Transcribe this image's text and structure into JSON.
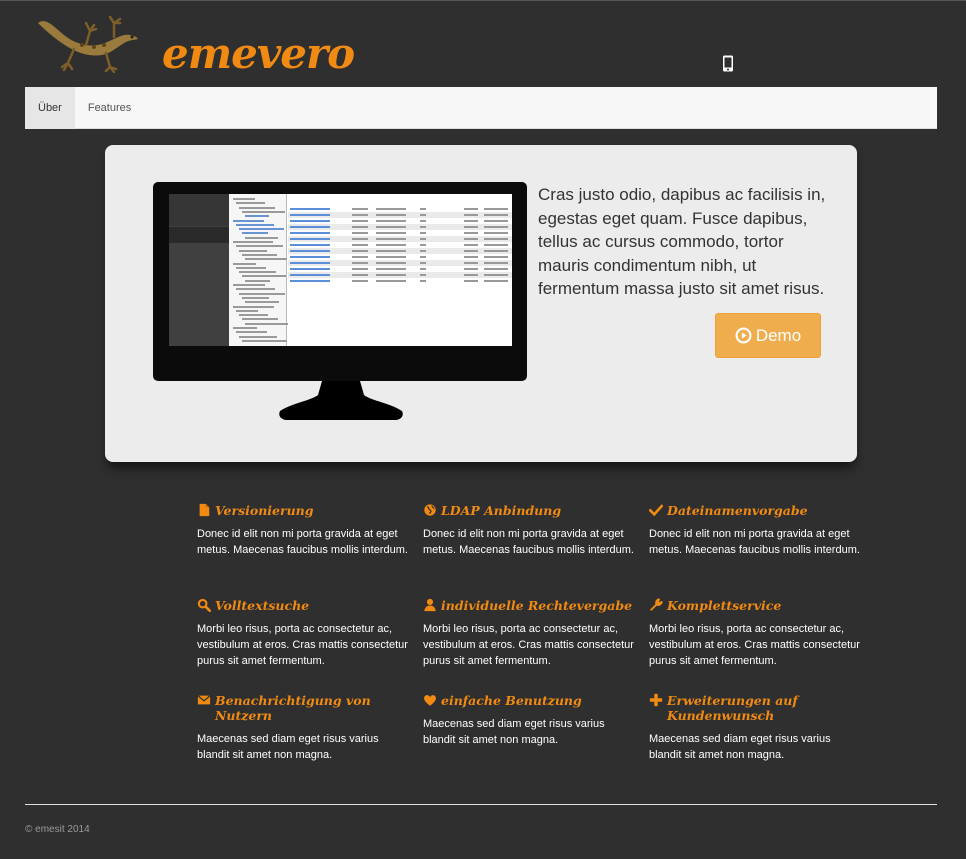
{
  "header": {
    "brand": "emevero",
    "logo_icon": "gecko-logo-icon",
    "mobile_icon": "mobile-phone-icon"
  },
  "nav": {
    "items": [
      {
        "label": "Über",
        "active": true
      },
      {
        "label": "Features",
        "active": false
      }
    ]
  },
  "hero": {
    "text": "Cras justo odio, dapibus ac facilisis in, egestas eget quam. Fusce dapibus, tellus ac cursus commodo, tortor mauris condimentum nibh, ut fermentum massa justo sit amet risus.",
    "demo_label": "Demo",
    "demo_icon": "play-circle-icon",
    "button_color": "#f0ad4e"
  },
  "features": [
    {
      "icon": "file-icon",
      "title": "Versionierung",
      "text": "Donec id elit non mi porta gravida at eget metus. Maecenas faucibus mollis interdum."
    },
    {
      "icon": "globe-icon",
      "title": "LDAP Anbindung",
      "text": "Donec id elit non mi porta gravida at eget metus. Maecenas faucibus mollis interdum."
    },
    {
      "icon": "check-icon",
      "title": "Dateinamenvorgabe",
      "text": "Donec id elit non mi porta gravida at eget metus. Maecenas faucibus mollis interdum."
    },
    {
      "icon": "search-icon",
      "title": "Volltextsuche",
      "text": "Morbi leo risus, porta ac consectetur ac, vestibulum at eros. Cras mattis consectetur purus sit amet fermentum."
    },
    {
      "icon": "user-icon",
      "title": "individuelle Rechtevergabe",
      "text": "Morbi leo risus, porta ac consectetur ac, vestibulum at eros. Cras mattis consectetur purus sit amet fermentum."
    },
    {
      "icon": "wrench-icon",
      "title": "Komplettservice",
      "text": "Morbi leo risus, porta ac consectetur ac, vestibulum at eros. Cras mattis consectetur purus sit amet fermentum."
    },
    {
      "icon": "envelope-icon",
      "title": "Benachrichtigung von Nutzern",
      "text": "Maecenas sed diam eget risus varius blandit sit amet non magna."
    },
    {
      "icon": "heart-icon",
      "title": "einfache Benutzung",
      "text": "Maecenas sed diam eget risus varius blandit sit amet non magna."
    },
    {
      "icon": "plus-icon",
      "title": "Erweiterungen auf Kundenwunsch",
      "text": "Maecenas sed diam eget risus varius blandit sit amet non magna."
    }
  ],
  "footer": {
    "copyright": "© emesit 2014"
  },
  "colors": {
    "background": "#2f2f2f",
    "accent": "#f08a12",
    "hero_bg": "#ececec"
  }
}
